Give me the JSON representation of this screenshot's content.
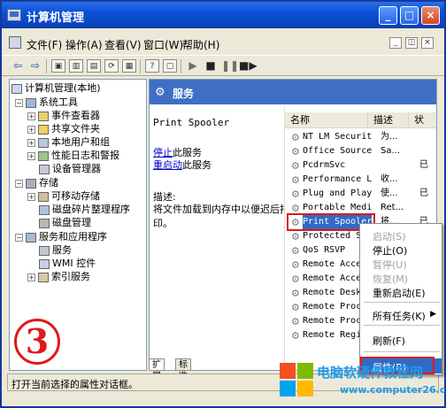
{
  "window": {
    "title": "计算机管理",
    "minimize": "_",
    "maximize": "□",
    "close": "×"
  },
  "menubar": {
    "items": [
      "文件(F)",
      "操作(A)",
      "查看(V)",
      "窗口(W)",
      "帮助(H)"
    ],
    "mdi_min": "_",
    "mdi_restore": "◫",
    "mdi_close": "×"
  },
  "toolbar": {
    "icons": [
      "back-arrow-icon",
      "forward-arrow-icon",
      "up-folder-icon",
      "console-tree-icon",
      "properties-icon",
      "refresh-icon",
      "export-icon",
      "help-icon",
      "console-icon",
      "play-icon",
      "stop-icon",
      "pause-icon",
      "restart-icon"
    ]
  },
  "tree": {
    "root": "计算机管理(本地)",
    "system_tools": "系统工具",
    "event_viewer": "事件查看器",
    "shared_folders": "共享文件夹",
    "local_users": "本地用户和组",
    "perf_logs": "性能日志和警报",
    "device_manager": "设备管理器",
    "storage": "存储",
    "removable": "可移动存储",
    "defrag": "磁盘碎片整理程序",
    "disk_mgmt": "磁盘管理",
    "services_apps": "服务和应用程序",
    "services": "服务",
    "wmi": "WMI 控件",
    "indexing": "索引服务"
  },
  "pane": {
    "header": "服务",
    "selected_service": "Print Spooler",
    "stop_link": "停止",
    "stop_suffix": "此服务",
    "restart_link": "重启动",
    "restart_suffix": "此服务",
    "desc_label": "描述:",
    "desc_text": "将文件加载到内存中以便迟后打印。"
  },
  "list": {
    "col_name": "名称",
    "col_desc": "描述",
    "col_status": "状",
    "rows": [
      {
        "name": "NT LM Security...",
        "desc": "为...",
        "status": ""
      },
      {
        "name": "Office Source ...",
        "desc": "Sa...",
        "status": ""
      },
      {
        "name": "PcdrmSvc",
        "desc": "",
        "status": "已"
      },
      {
        "name": "Performance Lo...",
        "desc": "收...",
        "status": ""
      },
      {
        "name": "Plug and Play",
        "desc": "使...",
        "status": "已"
      },
      {
        "name": "Portable Media...",
        "desc": "Ret...",
        "status": ""
      },
      {
        "name": "Print Spooler",
        "desc": "将...",
        "status": "已"
      },
      {
        "name": "Protected Stor",
        "desc": "",
        "status": ""
      },
      {
        "name": "QoS RSVP",
        "desc": "",
        "status": ""
      },
      {
        "name": "Remote Access",
        "desc": "",
        "status": ""
      },
      {
        "name": "Remote Access",
        "desc": "",
        "status": ""
      },
      {
        "name": "Remote Desktop",
        "desc": "",
        "status": ""
      },
      {
        "name": "Remote Procedu",
        "desc": "",
        "status": ""
      },
      {
        "name": "Remote Procedu",
        "desc": "",
        "status": ""
      },
      {
        "name": "Remote Registr",
        "desc": "",
        "status": ""
      }
    ]
  },
  "tabs": {
    "extended": "扩展",
    "standard": "标准"
  },
  "status": "打开当前选择的属性对话框。",
  "context_menu": {
    "start": "启动(S)",
    "stop": "停止(O)",
    "pause": "暂停(U)",
    "resume": "恢复(M)",
    "restart": "重新启动(E)",
    "all_tasks": "所有任务(K)",
    "refresh": "刷新(F)",
    "properties": "属性(R)"
  },
  "annotation": {
    "step": "3"
  },
  "watermark": {
    "line1": "电脑软硬件教程网",
    "line2": "www.computer26.com"
  },
  "colors": {
    "accent": "#0a46c6",
    "selection": "#316ac5",
    "highlight_red": "#e01818",
    "watermark": "#1e9be8"
  }
}
